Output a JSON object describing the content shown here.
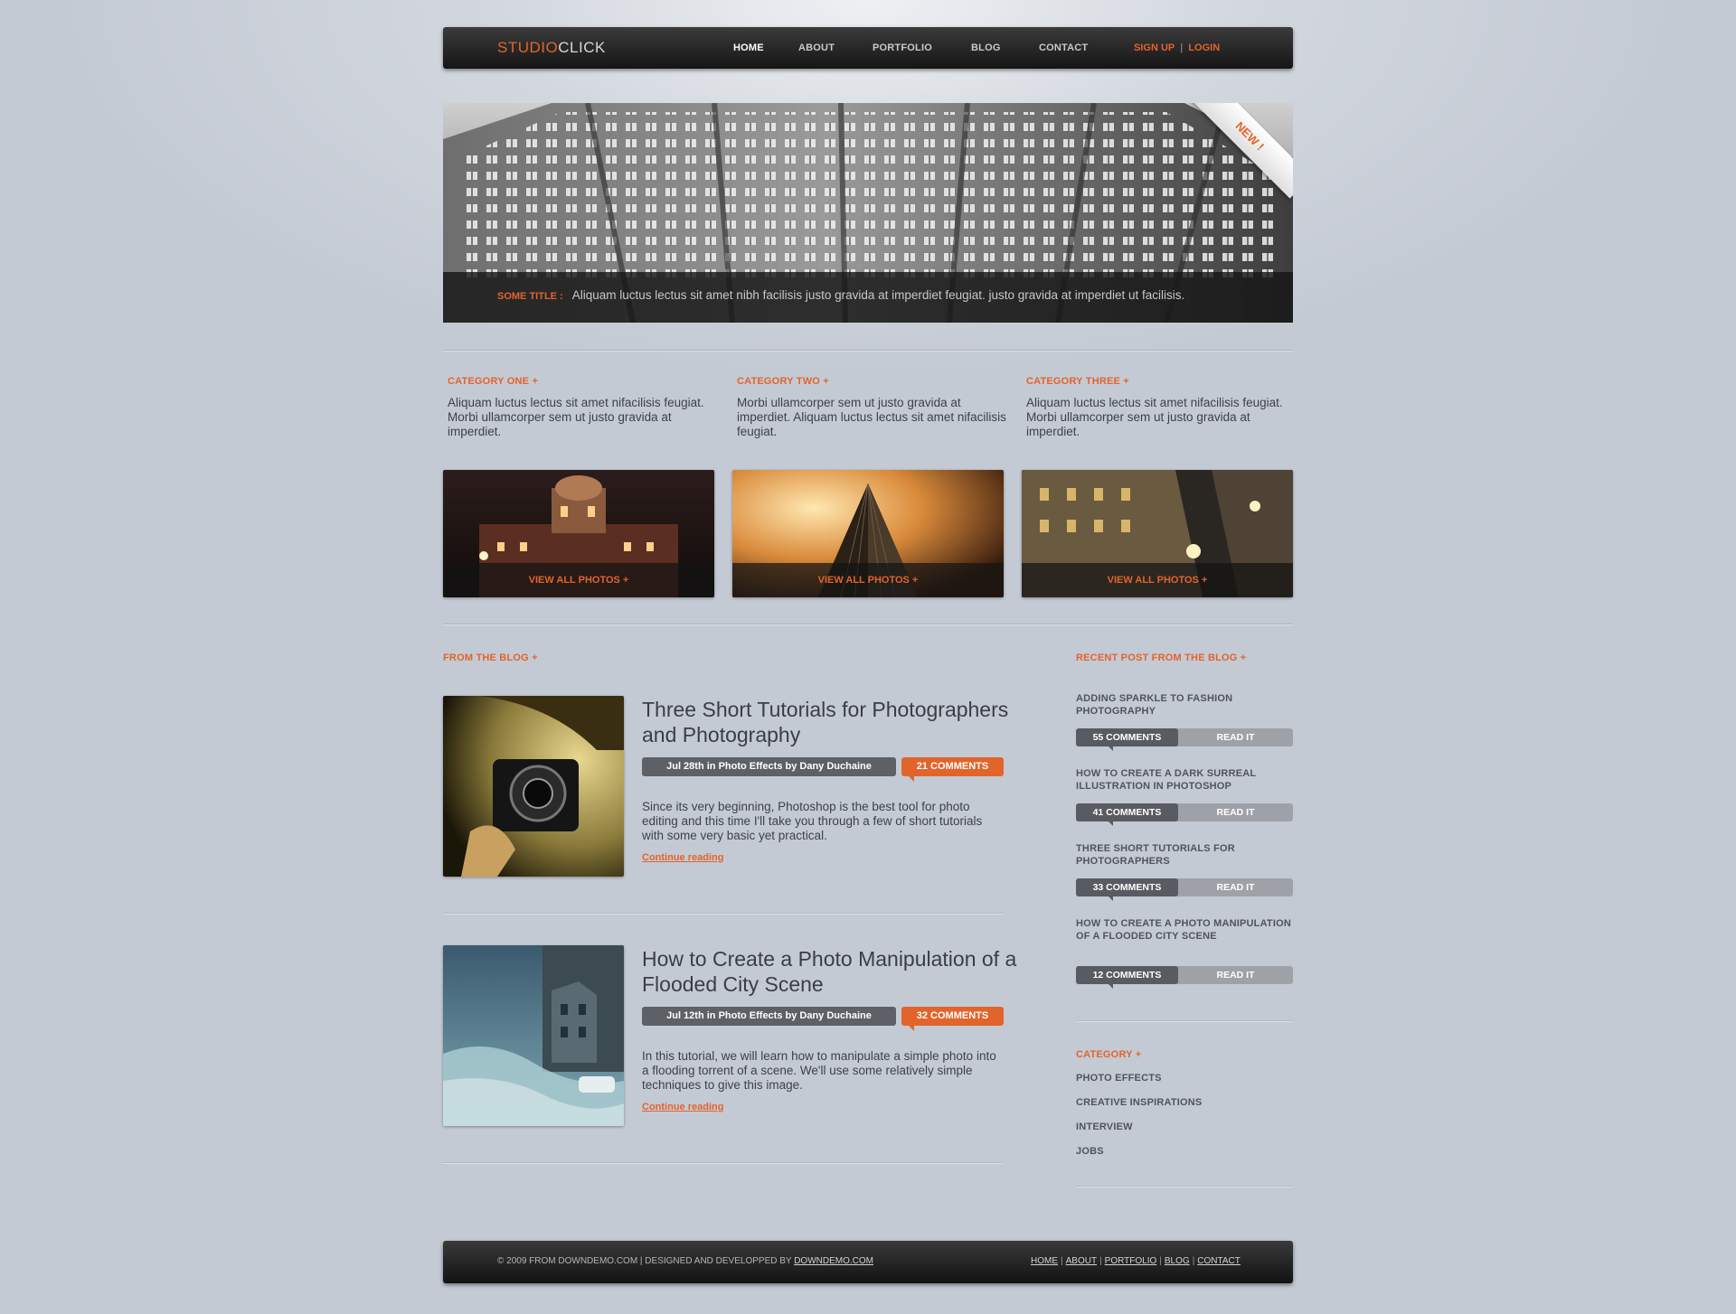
{
  "header": {
    "logo_part1": "STUDIO",
    "logo_part2": "CLICK",
    "nav": [
      "HOME",
      "ABOUT",
      "PORTFOLIO",
      "BLOG",
      "CONTACT"
    ],
    "signup": "SIGN UP",
    "separator": "|",
    "login": "LOGIN"
  },
  "hero": {
    "badge": "NEW !",
    "caption_title": "SOME TITLE :",
    "caption_text": "Aliquam luctus lectus sit amet nibh facilisis justo gravida at imperdiet feugiat. justo gravida at imperdiet ut facilisis."
  },
  "categories": [
    {
      "title": "CATEGORY ONE +",
      "text": "Aliquam luctus lectus sit amet nifacilisis feugiat. Morbi ullamcorper sem ut justo gravida at imperdiet.",
      "link": "VIEW ALL PHOTOS +"
    },
    {
      "title": "CATEGORY TWO +",
      "text": "Morbi ullamcorper sem ut justo gravida at imperdiet. Aliquam luctus lectus sit amet nifacilisis feugiat.",
      "link": "VIEW ALL PHOTOS +"
    },
    {
      "title": "CATEGORY THREE +",
      "text": "Aliquam luctus lectus sit amet nifacilisis feugiat. Morbi ullamcorper sem ut justo gravida at imperdiet.",
      "link": "VIEW ALL PHOTOS +"
    }
  ],
  "blog": {
    "label": "FROM THE BLOG +",
    "posts": [
      {
        "title": "Three Short Tutorials for Photographers and Photography",
        "meta": "Jul 28th in Photo Effects by Dany Duchaine",
        "comments": "21 COMMENTS",
        "excerpt": "Since its very beginning, Photoshop is the best tool for photo editing and this time I'll take you through a few of short tutorials with some very basic yet practical.",
        "more": "Continue reading"
      },
      {
        "title": "How to Create a Photo Manipulation of a Flooded City Scene",
        "meta": "Jul 12th in Photo Effects by Dany Duchaine",
        "comments": "32 COMMENTS",
        "excerpt": "In this tutorial, we will learn how to manipulate a simple photo into a flooding torrent of a scene. We'll use some relatively simple techniques to give this image.",
        "more": "Continue reading"
      }
    ]
  },
  "sidebar": {
    "recent_label": "RECENT POST FROM THE BLOG +",
    "recent": [
      {
        "title": "ADDING SPARKLE TO FASHION PHOTOGRAPHY",
        "comments": "55 COMMENTS",
        "read": "READ IT"
      },
      {
        "title": "HOW TO CREATE A DARK SURREAL ILLUSTRATION IN PHOTOSHOP",
        "comments": "41 COMMENTS",
        "read": "READ IT"
      },
      {
        "title": "THREE SHORT TUTORIALS FOR PHOTOGRAPHERS",
        "comments": "33 COMMENTS",
        "read": "READ IT"
      },
      {
        "title": "HOW TO CREATE A PHOTO MANIPULATION OF A FLOODED CITY SCENE",
        "comments": "12 COMMENTS",
        "read": "READ IT"
      }
    ],
    "category_label": "CATEGORY +",
    "categories": [
      "PHOTO EFFECTS",
      "CREATIVE INSPIRATIONS",
      "INTERVIEW",
      "JOBS"
    ]
  },
  "footer": {
    "copyright": "© 2009 FROM DOWNDEMO.COM | DESIGNED AND DEVELOPPED BY",
    "designer_link": "DOWNDEMO.COM",
    "links": [
      "HOME",
      "ABOUT",
      "PORTFOLIO",
      "BLOG",
      "CONTACT"
    ]
  },
  "colors": {
    "accent": "#e2642b",
    "bar_dark": "#151515",
    "background": "#c4cad4"
  }
}
